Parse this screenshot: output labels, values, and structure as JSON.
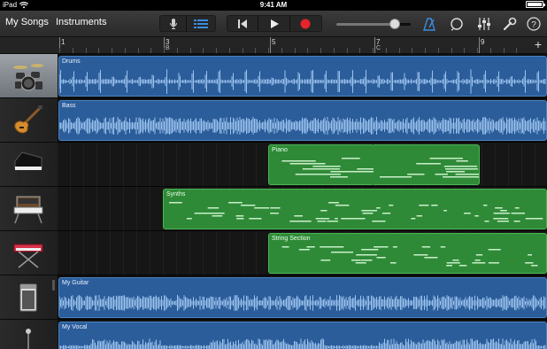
{
  "status_bar": {
    "carrier": "iPad",
    "time": "9:41 AM"
  },
  "toolbar": {
    "my_songs_label": "My Songs",
    "instruments_label": "Instruments"
  },
  "ruler": {
    "bars": [
      {
        "num": "1",
        "letter": ""
      },
      {
        "num": "3",
        "letter": "B"
      },
      {
        "num": "5",
        "letter": ""
      },
      {
        "num": "7",
        "letter": "C"
      },
      {
        "num": "9",
        "letter": ""
      }
    ]
  },
  "tracks": [
    {
      "name": "Drums",
      "icon": "drum-kit-icon",
      "type": "audio",
      "selected": true
    },
    {
      "name": "Bass",
      "icon": "bass-guitar-icon",
      "type": "audio"
    },
    {
      "name": "Piano",
      "icon": "grand-piano-icon",
      "type": "midi"
    },
    {
      "name": "Synths",
      "icon": "synthesizer-icon",
      "type": "midi"
    },
    {
      "name": "String Section",
      "icon": "keyboard-stand-icon",
      "type": "midi"
    },
    {
      "name": "My Guitar",
      "icon": "amplifier-icon",
      "type": "audio"
    },
    {
      "name": "My Vocal",
      "icon": "microphone-icon",
      "type": "audio"
    }
  ],
  "regions": {
    "drums": "Drums",
    "bass": "Bass",
    "piano": "Piano",
    "synths": "Synths",
    "strings": "String Section",
    "guitar": "My Guitar",
    "vocal": "My Vocal"
  },
  "colors": {
    "audio_region": "#2b5d9a",
    "midi_region": "#2f8a38",
    "record": "#e5242b",
    "accent_blue": "#3a8de0"
  },
  "icons": {
    "mic": "microphone-icon",
    "tracks_view": "tracks-view-icon",
    "rewind": "go-to-beginning-icon",
    "play": "play-icon",
    "record": "record-icon",
    "metronome": "metronome-icon",
    "loop": "loop-browser-icon",
    "mixer": "mixer-icon",
    "settings": "wrench-icon",
    "help": "help-icon",
    "add": "add-track-icon"
  }
}
